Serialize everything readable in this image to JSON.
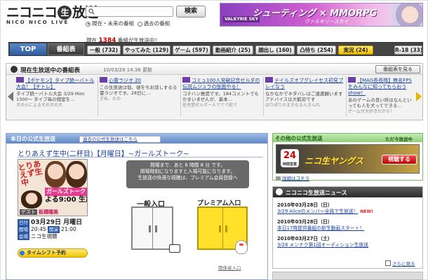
{
  "logo": {
    "main": "ニコニコ生放送",
    "live_glyph": "生",
    "sub": "NICO NICO LIVE"
  },
  "search": {
    "placeholder": "",
    "button": "検索",
    "options": [
      "現在・未来の番組",
      "過去の番組"
    ],
    "selected": 0
  },
  "banner": {
    "title": "シューティング × MMORPG",
    "subtitle": "ヴァルキリースカイ",
    "logo": "VALKYRIE SKY"
  },
  "broadcast_count": {
    "prefix": "現在",
    "count": "1384",
    "suffix": "番組が生放送中！"
  },
  "nav": {
    "top": "TOP",
    "schedule": "番組表",
    "categories": [
      {
        "label": "一般 (732)",
        "live": false
      },
      {
        "label": "やってみた (129)",
        "live": false
      },
      {
        "label": "ゲーム (597)",
        "live": false
      },
      {
        "label": "動画紹介 (25)",
        "live": false
      },
      {
        "label": "顔出し (160)",
        "live": false
      },
      {
        "label": "凸待ち (254)",
        "live": false
      },
      {
        "label": "実況 (24)",
        "live": true
      },
      {
        "label": "R-18 (33)",
        "live": false
      }
    ]
  },
  "schedule_panel": {
    "title": "現在生放送中の番組表",
    "updated": "10/03/29 14:36 更新",
    "view_button": "番組表を見る",
    "items": [
      {
        "title": "【ポケモン】タイプ統一バトル大会！【チトレ】",
        "desc": "タイプ統一バトル大会 3/29 Mon 1300～ タイプ毎の個室を…",
        "meta": "犬の火による犬の犬の犬"
      },
      {
        "title": "心霊ラジオ 20",
        "desc": "この生放送は悩、値をちお話しするる霊ラジオです。28日に…",
        "meta": "ぎぬ、たの"
      },
      {
        "title": "コミュ100人突破記念ゼルダの伝説ムジュラの仮面やる！",
        "desc": "コテハン推奨です。184コメントでもかまいませんが、基本…",
        "meta": "任天堂ゼルダー人ででで前で"
      },
      {
        "title": "テイルズオブグレイセス初見プレイなう",
        "desc": "なかなかでネタバレはご遠慮願います アドバイスは大歓迎です",
        "meta": "はりぽりかまきなるんきんれ"
      },
      {
        "title": "【MAG長長時】無名FPSをみんなに知ってもらおうshow！",
        "desc": "あのゲームの良い所はなんといっても人を犬ってできる…",
        "meta": "ゲームが大好きだから！"
      }
    ]
  },
  "official": {
    "header": "本日の公式生放送",
    "past_link": "過去の公式生放送はこちら",
    "program_title": "とりあえず生中(二杯目)【月曜日】~ガールズトーク~",
    "thumb": {
      "logo": "とりあえず生中",
      "band": "ガールズトーク",
      "time": "よる9:00 生放送!!",
      "guest_label": "ゲスト",
      "guest_name": "板橋瞳美"
    },
    "date_label": "日付",
    "date": "03月29日 月曜日",
    "open_label": "開場",
    "open_time": "20:45",
    "start_label": "開演",
    "start_time": "21:00",
    "venue_label": "会場",
    "venue": "ニコ生視聴",
    "timeshift": "タイムシフト予約",
    "notice_lines": [
      "開場まで、あと 6 時間 8 分 です。",
      "開場時刻になりますと入場可能になります。",
      "生放送の快適な視聴は、プレミアム会員登録へ"
    ],
    "notice_link": "プレミアム会員登録へ",
    "door_general": "一般入口",
    "door_premium": "プレミアム入口",
    "staff_link": "関係者入口"
  },
  "other_official": {
    "title": "その他の公式生放送",
    "right": "ただ今放送中",
    "banner_badge": "24",
    "banner_badge_sub": "時間営業",
    "banner_title": "ニコ生ヤングス",
    "watch_button": "視聴する",
    "detail_link": "詳細はコチラ"
  },
  "news": {
    "title": "ニコニコ生放送ニュース",
    "items": [
      {
        "date": "2010年03月28日（日）",
        "text": "3/29 Aliceのメンバー全員で生放送！",
        "new": "NEW!"
      },
      {
        "date": "2010年03月28日（日）",
        "text": "本日17時提供番組の新生動画スタート！",
        "new": ""
      },
      {
        "date": "2010年03月27日（土）",
        "text": "3/28 メンナク第1回オーディション生放送",
        "new": ""
      }
    ],
    "more": "さらに見る"
  }
}
